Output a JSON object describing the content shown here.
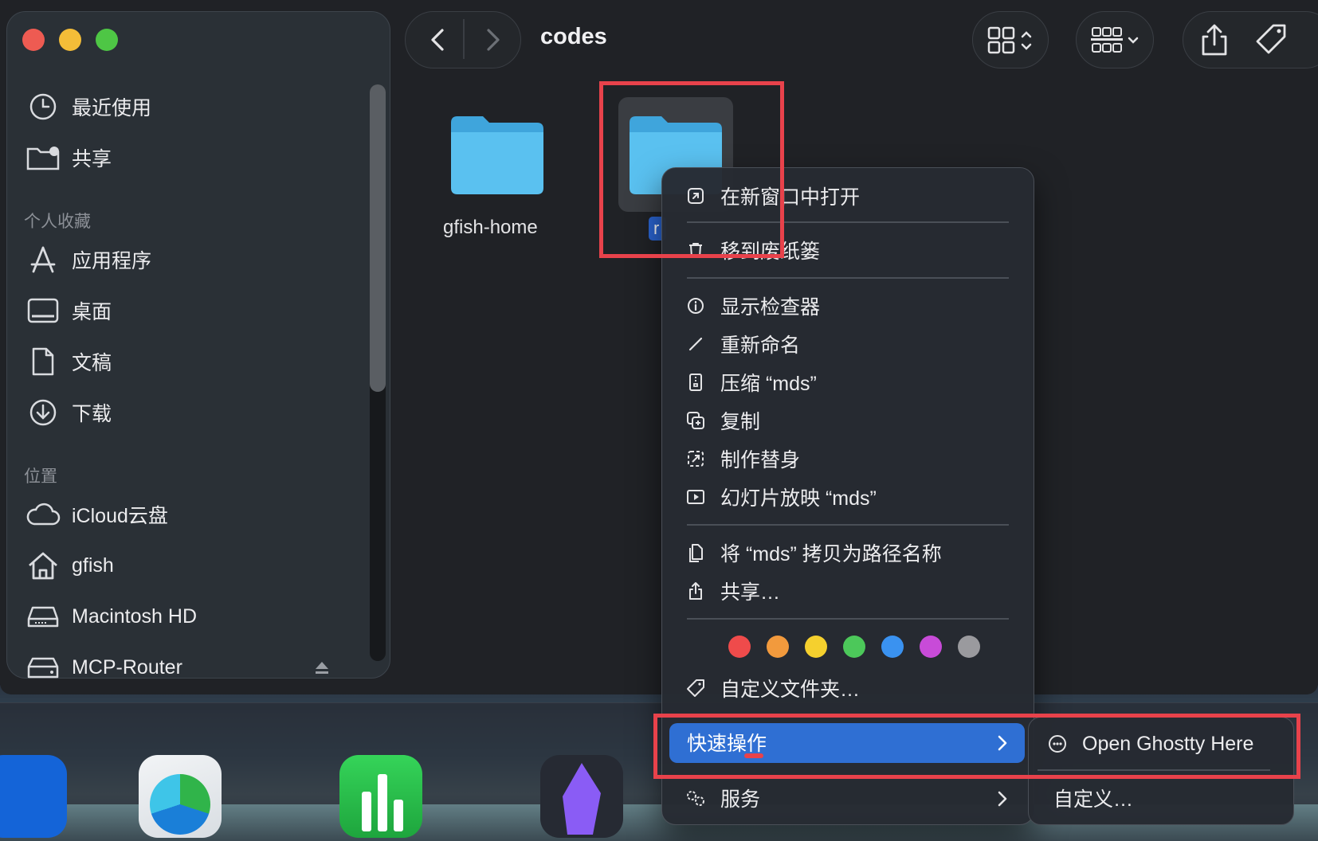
{
  "window": {
    "title": "codes"
  },
  "sidebar": {
    "top_items": [
      {
        "label": "最近使用",
        "icon": "clock-icon"
      },
      {
        "label": "共享",
        "icon": "shared-folder-icon"
      }
    ],
    "favorites_header": "个人收藏",
    "favorites": [
      {
        "label": "应用程序",
        "icon": "applications-icon"
      },
      {
        "label": "桌面",
        "icon": "desktop-icon"
      },
      {
        "label": "文稿",
        "icon": "document-icon"
      },
      {
        "label": "下载",
        "icon": "download-icon"
      }
    ],
    "locations_header": "位置",
    "locations": [
      {
        "label": "iCloud云盘",
        "icon": "cloud-icon"
      },
      {
        "label": "gfish",
        "icon": "home-icon"
      },
      {
        "label": "Macintosh HD",
        "icon": "drive-icon"
      },
      {
        "label": "MCP-Router",
        "icon": "drive-icon"
      }
    ]
  },
  "files": [
    {
      "name": "gfish-home",
      "icon": "folder-icon"
    },
    {
      "name": "mds",
      "icon": "folder-icon",
      "selected": true,
      "visible_name": "r"
    }
  ],
  "context_menu": {
    "items": [
      {
        "label": "在新窗口中打开",
        "icon": "open-window-icon"
      },
      {
        "label": "移到废纸篓",
        "icon": "trash-icon"
      },
      {
        "label": "显示检查器",
        "icon": "info-icon"
      },
      {
        "label": "重新命名",
        "icon": "pencil-icon"
      },
      {
        "label": "压缩 “mds”",
        "icon": "zip-icon"
      },
      {
        "label": "复制",
        "icon": "duplicate-icon"
      },
      {
        "label": "制作替身",
        "icon": "alias-icon"
      },
      {
        "label": "幻灯片放映 “mds”",
        "icon": "slideshow-icon"
      },
      {
        "label": "将 “mds” 拷贝为路径名称",
        "icon": "copy-path-icon"
      },
      {
        "label": "共享…",
        "icon": "share-icon"
      },
      {
        "label": "自定义文件夹…",
        "icon": "tag-icon"
      },
      {
        "label": "快速操作",
        "icon": ""
      },
      {
        "label": "服务",
        "icon": "gears-icon"
      }
    ],
    "tag_colors": [
      "#ef4b4b",
      "#f29a3d",
      "#f5d02e",
      "#4cc85a",
      "#3a92f0",
      "#c84bd8",
      "#9a9a9e"
    ],
    "highlight_color": "#2f6fd3"
  },
  "submenu": {
    "items": [
      {
        "label": "Open Ghostty Here",
        "icon": "ghostty-icon"
      },
      {
        "label": "自定义…",
        "icon": ""
      }
    ]
  }
}
